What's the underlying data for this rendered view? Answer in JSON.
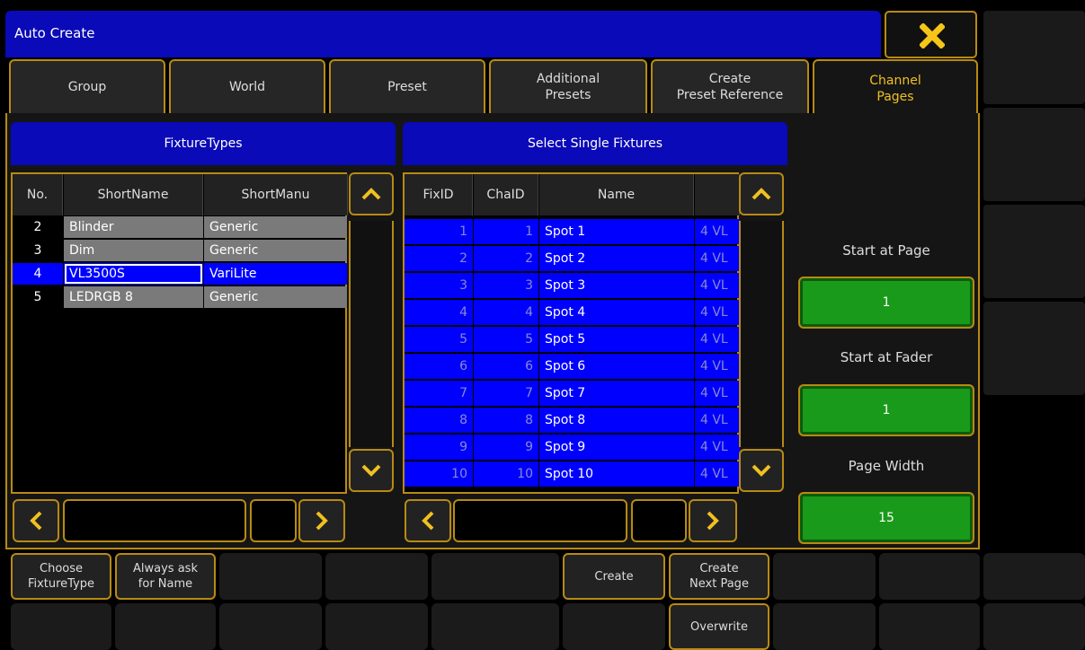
{
  "window": {
    "title": "Auto Create"
  },
  "tabs": [
    {
      "label": "Group",
      "active": false
    },
    {
      "label": "World",
      "active": false
    },
    {
      "label": "Preset",
      "active": false
    },
    {
      "label": "Additional\nPresets",
      "active": false
    },
    {
      "label": "Create\nPreset Reference",
      "active": false
    },
    {
      "label": "Channel\nPages",
      "active": true
    }
  ],
  "fixture_types": {
    "header": "FixtureTypes",
    "columns": [
      "No.",
      "ShortName",
      "ShortManu"
    ],
    "rows": [
      {
        "no": "2",
        "short_name": "Blinder",
        "short_manu": "Generic",
        "selected": false
      },
      {
        "no": "3",
        "short_name": "Dim",
        "short_manu": "Generic",
        "selected": false
      },
      {
        "no": "4",
        "short_name": "VL3500S",
        "short_manu": "VariLite",
        "selected": true
      },
      {
        "no": "5",
        "short_name": "LEDRGB 8",
        "short_manu": "Generic",
        "selected": false
      }
    ]
  },
  "single_fixtures": {
    "header": "Select Single Fixtures",
    "columns": [
      "FixID",
      "ChaID",
      "Name",
      ""
    ],
    "rows": [
      {
        "fix_id": "1",
        "cha_id": "1",
        "name": "Spot 1",
        "extra": "4 VL"
      },
      {
        "fix_id": "2",
        "cha_id": "2",
        "name": "Spot 2",
        "extra": "4 VL"
      },
      {
        "fix_id": "3",
        "cha_id": "3",
        "name": "Spot 3",
        "extra": "4 VL"
      },
      {
        "fix_id": "4",
        "cha_id": "4",
        "name": "Spot 4",
        "extra": "4 VL"
      },
      {
        "fix_id": "5",
        "cha_id": "5",
        "name": "Spot 5",
        "extra": "4 VL"
      },
      {
        "fix_id": "6",
        "cha_id": "6",
        "name": "Spot 6",
        "extra": "4 VL"
      },
      {
        "fix_id": "7",
        "cha_id": "7",
        "name": "Spot 7",
        "extra": "4 VL"
      },
      {
        "fix_id": "8",
        "cha_id": "8",
        "name": "Spot 8",
        "extra": "4 VL"
      },
      {
        "fix_id": "9",
        "cha_id": "9",
        "name": "Spot 9",
        "extra": "4 VL"
      },
      {
        "fix_id": "10",
        "cha_id": "10",
        "name": "Spot 10",
        "extra": "4 VL"
      }
    ]
  },
  "settings": {
    "start_page_label": "Start at Page",
    "start_page_value": "1",
    "start_fader_label": "Start at Fader",
    "start_fader_value": "1",
    "page_width_label": "Page Width",
    "page_width_value": "15"
  },
  "bottom_keys": {
    "choose_fixture_type": "Choose\nFixtureType",
    "always_ask_name": "Always ask\nfor Name",
    "create": "Create",
    "create_next_page": "Create\nNext Page",
    "overwrite": "Overwrite"
  },
  "icons": {
    "close": "close-icon",
    "scroll_up": "chevron-up-icon",
    "scroll_down": "chevron-down-icon",
    "scroll_left": "chevron-left-icon",
    "scroll_right": "chevron-right-icon"
  },
  "colors": {
    "accent_gold": "#b88a12",
    "header_blue": "#0a0ab8",
    "select_blue": "#0000ff",
    "green": "#1a9a1a",
    "close_yellow": "#f5c518"
  }
}
